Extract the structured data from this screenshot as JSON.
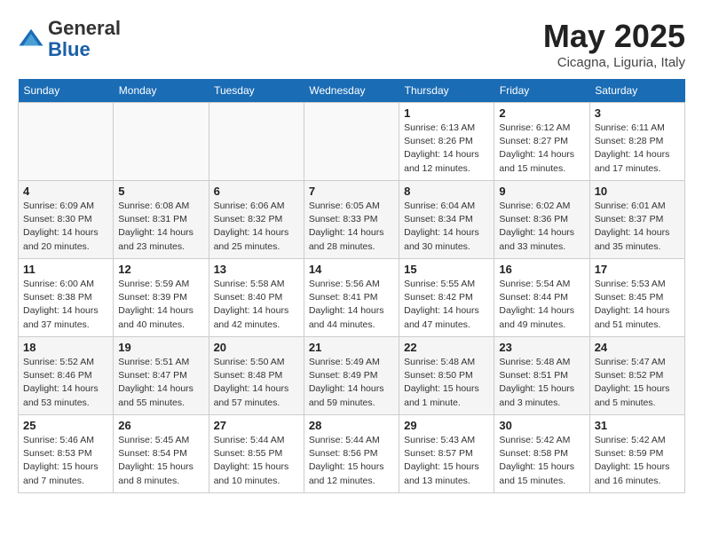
{
  "header": {
    "logo_general": "General",
    "logo_blue": "Blue",
    "month_title": "May 2025",
    "location": "Cicagna, Liguria, Italy"
  },
  "days_of_week": [
    "Sunday",
    "Monday",
    "Tuesday",
    "Wednesday",
    "Thursday",
    "Friday",
    "Saturday"
  ],
  "weeks": [
    [
      {
        "day": "",
        "info": ""
      },
      {
        "day": "",
        "info": ""
      },
      {
        "day": "",
        "info": ""
      },
      {
        "day": "",
        "info": ""
      },
      {
        "day": "1",
        "info": "Sunrise: 6:13 AM\nSunset: 8:26 PM\nDaylight: 14 hours\nand 12 minutes."
      },
      {
        "day": "2",
        "info": "Sunrise: 6:12 AM\nSunset: 8:27 PM\nDaylight: 14 hours\nand 15 minutes."
      },
      {
        "day": "3",
        "info": "Sunrise: 6:11 AM\nSunset: 8:28 PM\nDaylight: 14 hours\nand 17 minutes."
      }
    ],
    [
      {
        "day": "4",
        "info": "Sunrise: 6:09 AM\nSunset: 8:30 PM\nDaylight: 14 hours\nand 20 minutes."
      },
      {
        "day": "5",
        "info": "Sunrise: 6:08 AM\nSunset: 8:31 PM\nDaylight: 14 hours\nand 23 minutes."
      },
      {
        "day": "6",
        "info": "Sunrise: 6:06 AM\nSunset: 8:32 PM\nDaylight: 14 hours\nand 25 minutes."
      },
      {
        "day": "7",
        "info": "Sunrise: 6:05 AM\nSunset: 8:33 PM\nDaylight: 14 hours\nand 28 minutes."
      },
      {
        "day": "8",
        "info": "Sunrise: 6:04 AM\nSunset: 8:34 PM\nDaylight: 14 hours\nand 30 minutes."
      },
      {
        "day": "9",
        "info": "Sunrise: 6:02 AM\nSunset: 8:36 PM\nDaylight: 14 hours\nand 33 minutes."
      },
      {
        "day": "10",
        "info": "Sunrise: 6:01 AM\nSunset: 8:37 PM\nDaylight: 14 hours\nand 35 minutes."
      }
    ],
    [
      {
        "day": "11",
        "info": "Sunrise: 6:00 AM\nSunset: 8:38 PM\nDaylight: 14 hours\nand 37 minutes."
      },
      {
        "day": "12",
        "info": "Sunrise: 5:59 AM\nSunset: 8:39 PM\nDaylight: 14 hours\nand 40 minutes."
      },
      {
        "day": "13",
        "info": "Sunrise: 5:58 AM\nSunset: 8:40 PM\nDaylight: 14 hours\nand 42 minutes."
      },
      {
        "day": "14",
        "info": "Sunrise: 5:56 AM\nSunset: 8:41 PM\nDaylight: 14 hours\nand 44 minutes."
      },
      {
        "day": "15",
        "info": "Sunrise: 5:55 AM\nSunset: 8:42 PM\nDaylight: 14 hours\nand 47 minutes."
      },
      {
        "day": "16",
        "info": "Sunrise: 5:54 AM\nSunset: 8:44 PM\nDaylight: 14 hours\nand 49 minutes."
      },
      {
        "day": "17",
        "info": "Sunrise: 5:53 AM\nSunset: 8:45 PM\nDaylight: 14 hours\nand 51 minutes."
      }
    ],
    [
      {
        "day": "18",
        "info": "Sunrise: 5:52 AM\nSunset: 8:46 PM\nDaylight: 14 hours\nand 53 minutes."
      },
      {
        "day": "19",
        "info": "Sunrise: 5:51 AM\nSunset: 8:47 PM\nDaylight: 14 hours\nand 55 minutes."
      },
      {
        "day": "20",
        "info": "Sunrise: 5:50 AM\nSunset: 8:48 PM\nDaylight: 14 hours\nand 57 minutes."
      },
      {
        "day": "21",
        "info": "Sunrise: 5:49 AM\nSunset: 8:49 PM\nDaylight: 14 hours\nand 59 minutes."
      },
      {
        "day": "22",
        "info": "Sunrise: 5:48 AM\nSunset: 8:50 PM\nDaylight: 15 hours\nand 1 minute."
      },
      {
        "day": "23",
        "info": "Sunrise: 5:48 AM\nSunset: 8:51 PM\nDaylight: 15 hours\nand 3 minutes."
      },
      {
        "day": "24",
        "info": "Sunrise: 5:47 AM\nSunset: 8:52 PM\nDaylight: 15 hours\nand 5 minutes."
      }
    ],
    [
      {
        "day": "25",
        "info": "Sunrise: 5:46 AM\nSunset: 8:53 PM\nDaylight: 15 hours\nand 7 minutes."
      },
      {
        "day": "26",
        "info": "Sunrise: 5:45 AM\nSunset: 8:54 PM\nDaylight: 15 hours\nand 8 minutes."
      },
      {
        "day": "27",
        "info": "Sunrise: 5:44 AM\nSunset: 8:55 PM\nDaylight: 15 hours\nand 10 minutes."
      },
      {
        "day": "28",
        "info": "Sunrise: 5:44 AM\nSunset: 8:56 PM\nDaylight: 15 hours\nand 12 minutes."
      },
      {
        "day": "29",
        "info": "Sunrise: 5:43 AM\nSunset: 8:57 PM\nDaylight: 15 hours\nand 13 minutes."
      },
      {
        "day": "30",
        "info": "Sunrise: 5:42 AM\nSunset: 8:58 PM\nDaylight: 15 hours\nand 15 minutes."
      },
      {
        "day": "31",
        "info": "Sunrise: 5:42 AM\nSunset: 8:59 PM\nDaylight: 15 hours\nand 16 minutes."
      }
    ]
  ]
}
